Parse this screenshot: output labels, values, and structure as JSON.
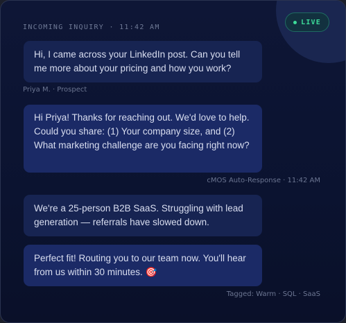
{
  "status_badge": {
    "label": "LIVE",
    "color": "#3ddc9a"
  },
  "header": {
    "label": "INCOMING INQUIRY · 11:42 AM"
  },
  "messages": [
    {
      "text": "Hi, I came across your LinkedIn post. Can you tell me more about your pricing and how you work?"
    },
    {
      "text": "Hi Priya! Thanks for reaching out. We'd love to help. Could you share: (1) Your company size, and (2) What marketing challenge are you facing right now?"
    },
    {
      "text": "We're a 25-person B2B SaaS. Struggling with lead generation — referrals have slowed down."
    },
    {
      "text": "Perfect fit! Routing you to our team now. You'll hear from us within 30 minutes. 🎯"
    }
  ],
  "meta": {
    "sender": "Priya M. · Prospect",
    "auto_response": "cMOS Auto-Response · 11:42 AM",
    "tags": "Tagged: Warm · SQL · SaaS"
  }
}
